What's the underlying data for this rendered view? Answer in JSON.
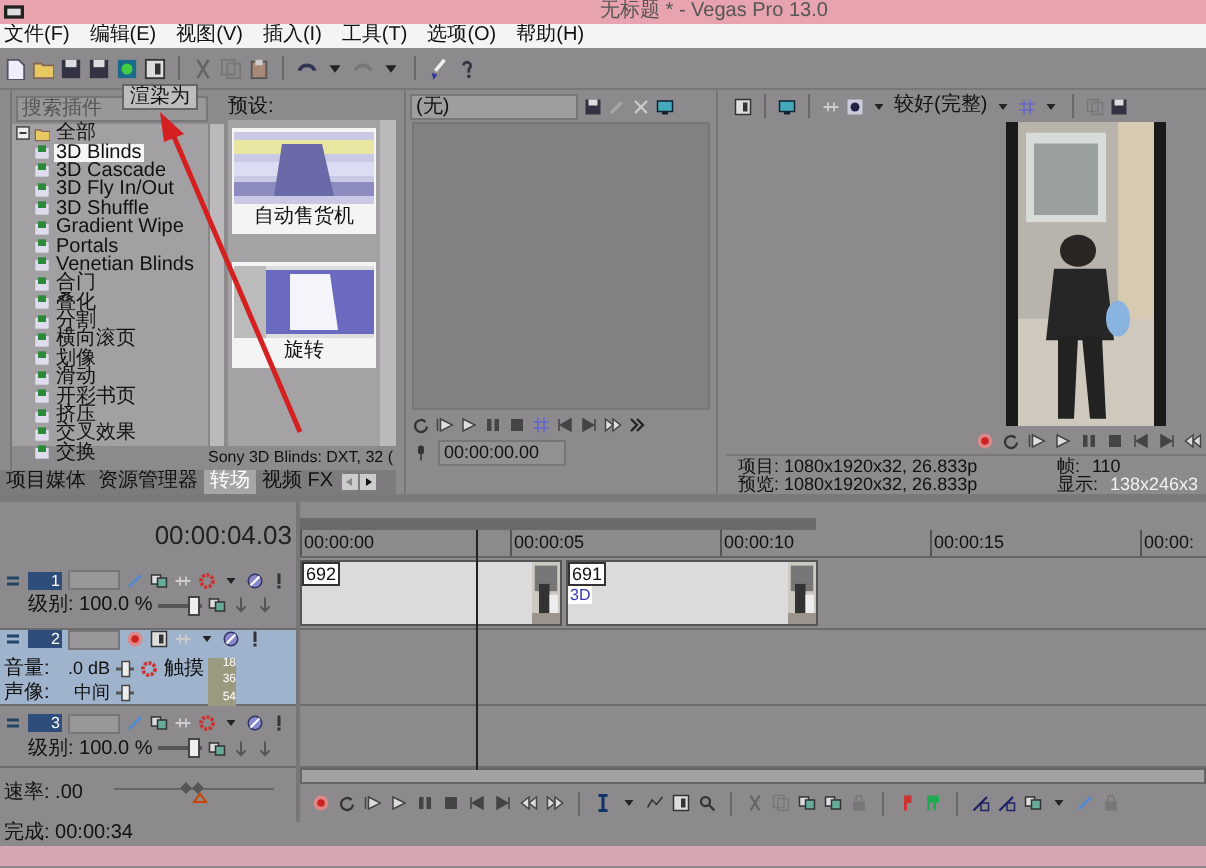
{
  "window": {
    "title": "无标题 * - Vegas Pro 13.0"
  },
  "menu": [
    "文件(F)",
    "编辑(E)",
    "视图(V)",
    "插入(I)",
    "工具(T)",
    "选项(O)",
    "帮助(H)"
  ],
  "tooltip": "渲染为",
  "transitions": {
    "search": {
      "placeholder": "搜索插件"
    },
    "tree": [
      {
        "label": "全部",
        "expanded": true,
        "children": [
          {
            "label": "3D Blinds",
            "selected": true
          },
          {
            "label": "3D Cascade",
            "selected": false
          },
          {
            "label": "3D Fly In/Out",
            "selected": false
          },
          {
            "label": "3D Shuffle",
            "selected": false
          },
          {
            "label": "Gradient Wipe",
            "selected": false
          },
          {
            "label": "Portals",
            "selected": false
          },
          {
            "label": "Venetian Blinds",
            "selected": false
          },
          {
            "label": "合门",
            "selected": false
          },
          {
            "label": "叠化",
            "selected": false
          },
          {
            "label": "分割",
            "selected": false
          },
          {
            "label": "横向滚页",
            "selected": false
          },
          {
            "label": "划像",
            "selected": false
          },
          {
            "label": "滑动",
            "selected": false
          },
          {
            "label": "开彩书页",
            "selected": false
          },
          {
            "label": "挤压",
            "selected": false
          },
          {
            "label": "交叉效果",
            "selected": false
          },
          {
            "label": "交换",
            "selected": false
          }
        ]
      }
    ],
    "presets_label": "预设:",
    "presets": [
      {
        "label": "自动售货机"
      },
      {
        "label": "旋转"
      }
    ],
    "status": "Sony 3D Blinds: DXT, 32 ("
  },
  "tabs": [
    {
      "label": "项目媒体",
      "selected": false
    },
    {
      "label": "资源管理器",
      "selected": false
    },
    {
      "label": "转场",
      "selected": true
    },
    {
      "label": "视频 FX",
      "selected": false
    }
  ],
  "trimmer": {
    "source": "(无)",
    "time": "00:00:00.00"
  },
  "preview": {
    "quality": "较好(完整)",
    "info": [
      {
        "label": "项目:",
        "value": "1080x1920x32, 26.833p"
      },
      {
        "label": "预览:",
        "value": "1080x1920x32, 26.833p"
      }
    ],
    "stats": [
      {
        "label": "帧:",
        "value": "110"
      },
      {
        "label": "显示:",
        "value": "138x246x3"
      }
    ]
  },
  "timeline": {
    "time": "00:00:04.03",
    "ruler": [
      "00:00:00",
      "00:00:05",
      "00:00:10",
      "00:00:15",
      "00:00:"
    ],
    "tracks": [
      {
        "kind": "video",
        "number": "1",
        "selected": false,
        "level_label": "级别: 100.0 %",
        "level": 0.8,
        "events": [
          {
            "label": "692"
          },
          {
            "label": "691",
            "sublabel": "3D"
          }
        ]
      },
      {
        "kind": "audio",
        "number": "2",
        "selected": true,
        "volume_label": "音量:",
        "volume": ".0 dB",
        "automation": "触摸",
        "pan_label": "声像:",
        "pan": "中间",
        "meter": [
          "18",
          "36",
          "54"
        ]
      },
      {
        "kind": "video",
        "number": "3",
        "selected": false,
        "level_label": "级别: 100.0 %",
        "level": 0.8
      }
    ],
    "rate": {
      "label": "速率: .00",
      "level": 0.5
    },
    "status": "完成: 00:00:34"
  }
}
